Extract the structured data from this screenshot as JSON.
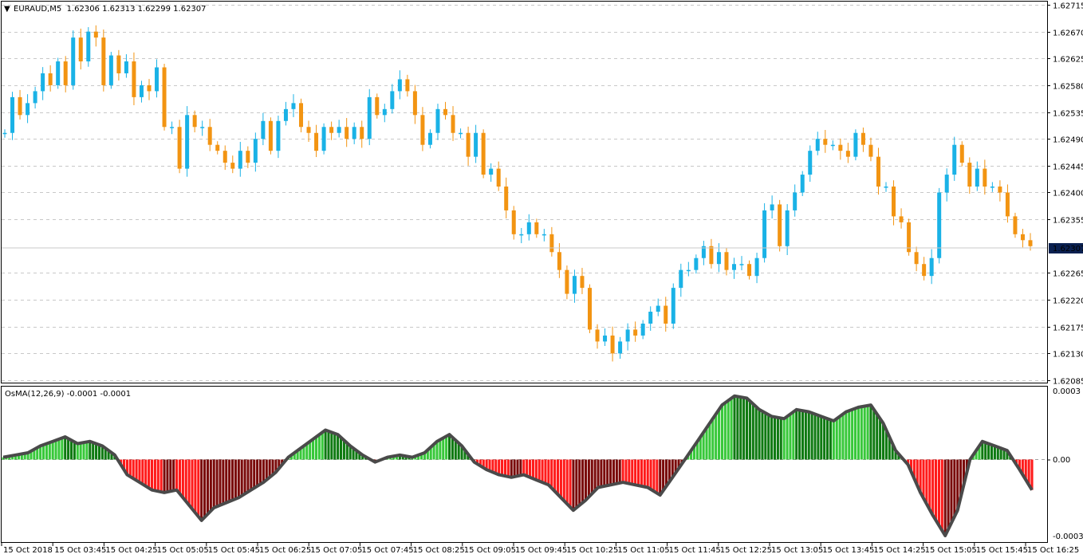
{
  "main_chart": {
    "symbol_line": "EURAUD,M5  1.62306 1.62313 1.62299 1.62307",
    "symbol_arrow": "▼",
    "type": "candlestick",
    "price_ticks": [
      "1.62715",
      "1.62670",
      "1.62625",
      "1.62580",
      "1.62535",
      "1.62490",
      "1.62445",
      "1.62400",
      "1.62355",
      "1.62307",
      "1.62265",
      "1.62220",
      "1.62175",
      "1.62130",
      "1.62085"
    ],
    "current_price_label": "1.62307",
    "colors": {
      "bull": "#1ab2e6",
      "bear": "#f29412",
      "current_price_bg": "#0a2050",
      "current_price_text": "#ffffff"
    },
    "ylim": [
      1.62085,
      1.62715
    ]
  },
  "indicator": {
    "title": "OsMA(12,26,9) -0.0001 -0.0001",
    "ticks": [
      "0.0003",
      "0.00",
      "-0.0003"
    ],
    "colors": {
      "pos_rising": "#38c83a",
      "pos_falling": "#0f7a12",
      "neg_falling": "#ff1a1a",
      "neg_rising": "#7a0a0a",
      "line": "#4a4a4a"
    }
  },
  "x_axis": {
    "labels": [
      "15 Oct 2018",
      "15 Oct 03:45",
      "15 Oct 04:25",
      "15 Oct 05:05",
      "15 Oct 05:45",
      "15 Oct 06:25",
      "15 Oct 07:05",
      "15 Oct 07:45",
      "15 Oct 08:25",
      "15 Oct 09:05",
      "15 Oct 09:45",
      "15 Oct 10:25",
      "15 Oct 11:05",
      "15 Oct 11:45",
      "15 Oct 12:25",
      "15 Oct 13:05",
      "15 Oct 13:45",
      "15 Oct 14:25",
      "15 Oct 15:05",
      "15 Oct 15:45",
      "15 Oct 16:25"
    ]
  },
  "chart_data": [
    {
      "type": "candlestick",
      "title": "EURAUD,M5",
      "series": [
        {
          "name": "EURAUD,M5",
          "close_path": [
            1.625,
            1.6256,
            1.6253,
            1.6255,
            1.6257,
            1.626,
            1.6258,
            1.6262,
            1.6258,
            1.6266,
            1.6262,
            1.6267,
            1.6266,
            1.6258,
            1.6263,
            1.626,
            1.6262,
            1.6256,
            1.6258,
            1.6257,
            1.6261,
            1.6251,
            1.6251,
            1.6244,
            1.6253,
            1.6251,
            1.6251,
            1.6248,
            1.6247,
            1.6245,
            1.6244,
            1.6247,
            1.6245,
            1.6249,
            1.6252,
            1.6247,
            1.6252,
            1.6254,
            1.6255,
            1.6251,
            1.625,
            1.6247,
            1.6251,
            1.625,
            1.6251,
            1.6249,
            1.6251,
            1.6249,
            1.6256,
            1.6253,
            1.6254,
            1.6257,
            1.6259,
            1.6257,
            1.6253,
            1.6248,
            1.625,
            1.6254,
            1.6253,
            1.625,
            1.625,
            1.6246,
            1.625,
            1.6243,
            1.6244,
            1.6241,
            1.6237,
            1.6233,
            1.6233,
            1.6235,
            1.6233,
            1.6233,
            1.623,
            1.6227,
            1.6223,
            1.6226,
            1.6224,
            1.6217,
            1.6215,
            1.6216,
            1.6213,
            1.6215,
            1.6217,
            1.6216,
            1.6218,
            1.622,
            1.6221,
            1.6218,
            1.6224,
            1.6227,
            1.6227,
            1.6229,
            1.6231,
            1.6228,
            1.623,
            1.6227,
            1.6228,
            1.6228,
            1.6226,
            1.6229,
            1.6237,
            1.6238,
            1.6231,
            1.6237,
            1.624,
            1.6243,
            1.6247,
            1.6249,
            1.6248,
            1.6248,
            1.6247,
            1.6246,
            1.625,
            1.6248,
            1.6246,
            1.6241,
            1.6241,
            1.6236,
            1.6235,
            1.623,
            1.6228,
            1.6226,
            1.6229,
            1.624,
            1.6243,
            1.6248,
            1.6245,
            1.6241,
            1.6244,
            1.6241,
            1.6241,
            1.624,
            1.6236,
            1.6233,
            1.6232,
            1.6231
          ]
        },
        {
          "name": "OsMA(12,26,9)",
          "values": [
            1e-05,
            2e-05,
            3e-05,
            6e-05,
            8e-05,
            0.0001,
            7e-05,
            8e-05,
            6e-05,
            2e-05,
            -6e-05,
            -9e-05,
            -0.00012,
            -0.00013,
            -0.00012,
            -0.00018,
            -0.00024,
            -0.00019,
            -0.00017,
            -0.00015,
            -0.00012,
            -9e-05,
            -5e-05,
            1e-05,
            5e-05,
            9e-05,
            0.00013,
            0.00011,
            6e-05,
            2e-05,
            -1e-05,
            1e-05,
            2e-05,
            1e-05,
            3e-05,
            8e-05,
            0.00011,
            6e-05,
            -1e-05,
            -4e-05,
            -6e-05,
            -7e-05,
            -6e-05,
            -8e-05,
            -0.0001,
            -0.00015,
            -0.0002,
            -0.00016,
            -0.00011,
            -0.0001,
            -9e-05,
            -0.0001,
            -0.00011,
            -0.00014,
            -7e-05,
            0.0,
            8e-05,
            0.00016,
            0.00024,
            0.00028,
            0.00027,
            0.00022,
            0.00019,
            0.00018,
            0.00022,
            0.00021,
            0.00019,
            0.00017,
            0.00021,
            0.00023,
            0.00024,
            0.00016,
            4e-05,
            -2e-05,
            -0.00013,
            -0.00022,
            -0.0003,
            -0.0002,
            0.0,
            8e-05,
            6e-05,
            4e-05,
            -4e-05,
            -0.00012
          ]
        }
      ]
    }
  ]
}
